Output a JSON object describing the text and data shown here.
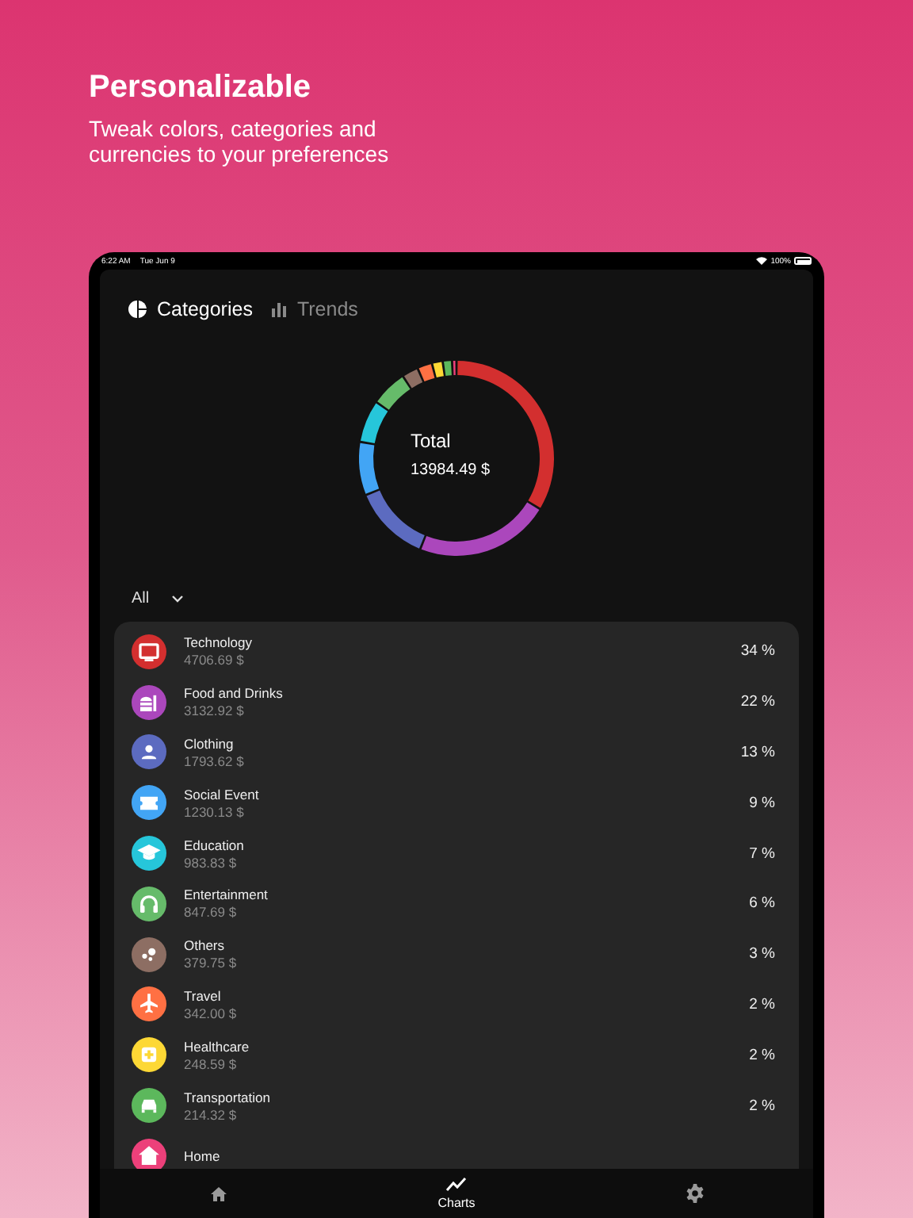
{
  "promo": {
    "title": "Personalizable",
    "subtitle": "Tweak colors, categories and currencies to your preferences"
  },
  "status_bar": {
    "time": "6:22 AM",
    "date": "Tue Jun 9",
    "battery": "100%"
  },
  "tabs": [
    {
      "label": "Categories",
      "selected": true
    },
    {
      "label": "Trends",
      "selected": false
    }
  ],
  "donut": {
    "label": "Total",
    "amount": "13984.49 $",
    "chart_data": {
      "type": "donut",
      "series": [
        {
          "values": [
            33.66,
            22.4,
            12.83,
            8.8,
            7.04,
            6.06,
            2.72,
            2.45,
            1.78,
            1.53,
            0.73
          ]
        }
      ]
    }
  },
  "filter": {
    "value": "All"
  },
  "categories": [
    {
      "name": "Technology",
      "amount": "4706.69 $",
      "percent": "34 %",
      "color": "#d32f2f"
    },
    {
      "name": "Food and Drinks",
      "amount": "3132.92 $",
      "percent": "22 %",
      "color": "#ab47bc"
    },
    {
      "name": "Clothing",
      "amount": "1793.62 $",
      "percent": "13 %",
      "color": "#5c6bc0"
    },
    {
      "name": "Social Event",
      "amount": "1230.13 $",
      "percent": "9 %",
      "color": "#42a5f5"
    },
    {
      "name": "Education",
      "amount": "983.83 $",
      "percent": "7 %",
      "color": "#26c6da"
    },
    {
      "name": "Entertainment",
      "amount": "847.69 $",
      "percent": "6 %",
      "color": "#66bb6a"
    },
    {
      "name": "Others",
      "amount": "379.75 $",
      "percent": "3 %",
      "color": "#8d6e63"
    },
    {
      "name": "Travel",
      "amount": "342.00 $",
      "percent": "2 %",
      "color": "#ff7043"
    },
    {
      "name": "Healthcare",
      "amount": "248.59 $",
      "percent": "2 %",
      "color": "#fdd835"
    },
    {
      "name": "Transportation",
      "amount": "214.32 $",
      "percent": "2 %",
      "color": "#5cb85c"
    },
    {
      "name": "Home",
      "color": "#ec407a"
    }
  ],
  "bottom_nav": [
    {
      "kind": "home",
      "selected": false
    },
    {
      "kind": "charts",
      "label": "Charts",
      "selected": true
    },
    {
      "kind": "settings",
      "selected": false
    }
  ]
}
